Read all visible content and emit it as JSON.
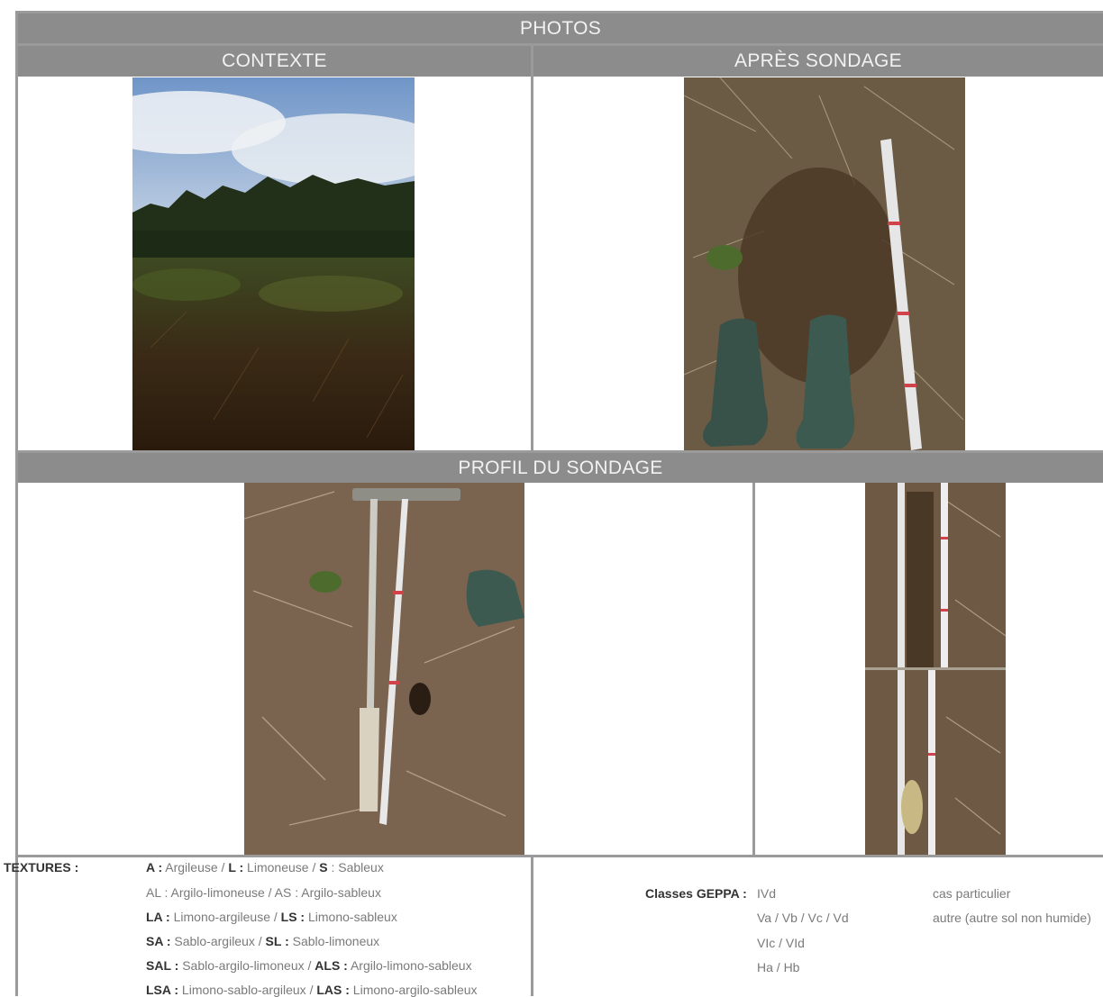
{
  "headers": {
    "photos": "PHOTOS",
    "contexte": "CONTEXTE",
    "apres": "APRÈS SONDAGE",
    "profil": "PROFIL DU SONDAGE"
  },
  "textures": {
    "title": "TEXTURES :",
    "lines": [
      [
        {
          "t": "A :",
          "b": true
        },
        {
          "t": " Argileuse / ",
          "b": false
        },
        {
          "t": "L :",
          "b": true
        },
        {
          "t": " Limoneuse / ",
          "b": false
        },
        {
          "t": "S",
          "b": true
        },
        {
          "t": " : Sableux",
          "b": false
        }
      ],
      [
        {
          "t": "AL : Argilo-limoneuse / AS : Argilo-sableux",
          "b": false
        }
      ],
      [
        {
          "t": "LA :",
          "b": true
        },
        {
          "t": " Limono-argileuse / ",
          "b": false
        },
        {
          "t": "LS :",
          "b": true
        },
        {
          "t": " Limono-sableux",
          "b": false
        }
      ],
      [
        {
          "t": "SA :",
          "b": true
        },
        {
          "t": " Sablo-argileux / ",
          "b": false
        },
        {
          "t": "SL :",
          "b": true
        },
        {
          "t": " Sablo-limoneux",
          "b": false
        }
      ],
      [
        {
          "t": "SAL :",
          "b": true
        },
        {
          "t": " Sablo-argilo-limoneux  / ",
          "b": false
        },
        {
          "t": "ALS :",
          "b": true
        },
        {
          "t": " Argilo-limono-sableux",
          "b": false
        }
      ],
      [
        {
          "t": "LSA :",
          "b": true
        },
        {
          "t": " Limono-sablo-argileux /  ",
          "b": false
        },
        {
          "t": "LAS :",
          "b": true
        },
        {
          "t": " Limono-argilo-sableux",
          "b": false
        }
      ]
    ]
  },
  "geppa": {
    "label": "Classes GEPPA :",
    "items": [
      "IVd",
      "Va / Vb / Vc / Vd",
      "VIc / VId",
      "Ha / Hb"
    ],
    "cas": [
      "cas particulier",
      "autre (autre sol non humide)"
    ]
  }
}
